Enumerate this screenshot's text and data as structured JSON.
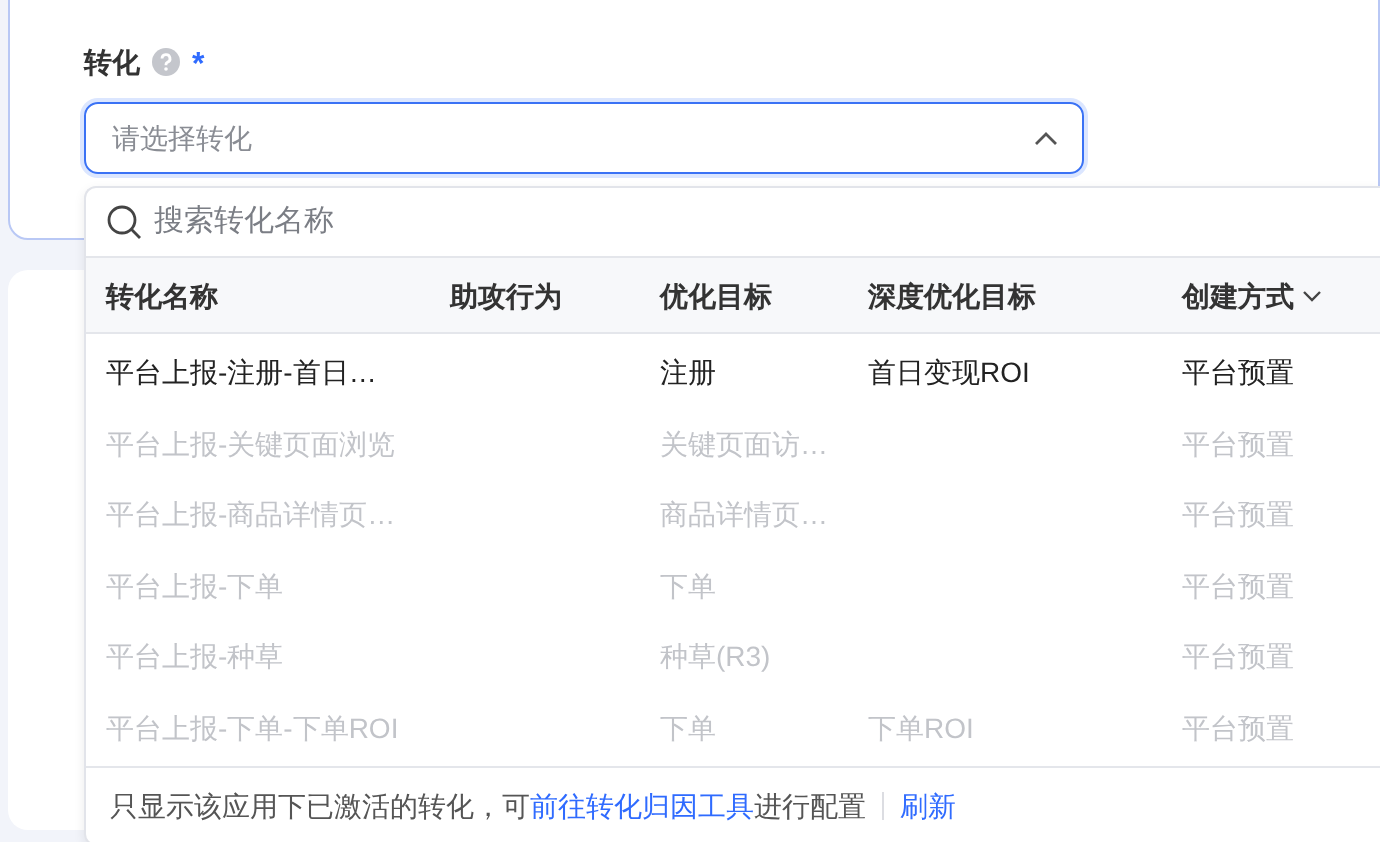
{
  "field": {
    "label": "转化",
    "required_mark": "*",
    "placeholder": "请选择转化",
    "expanded": true
  },
  "dropdown": {
    "search": {
      "placeholder": "搜索转化名称"
    },
    "table": {
      "columns": [
        {
          "label": "转化名称",
          "sortable": false
        },
        {
          "label": "助攻行为",
          "sortable": false
        },
        {
          "label": "优化目标",
          "sortable": false
        },
        {
          "label": "深度优化目标",
          "sortable": false
        },
        {
          "label": "创建方式",
          "sortable": true
        }
      ],
      "rows": [
        {
          "cells": [
            "平台上报-注册-首日…",
            "",
            "注册",
            "首日变现ROI",
            "平台预置"
          ],
          "disabled": false
        },
        {
          "cells": [
            "平台上报-关键页面浏览",
            "",
            "关键页面访…",
            "",
            "平台预置"
          ],
          "disabled": true
        },
        {
          "cells": [
            "平台上报-商品详情页…",
            "",
            "商品详情页…",
            "",
            "平台预置"
          ],
          "disabled": true
        },
        {
          "cells": [
            "平台上报-下单",
            "",
            "下单",
            "",
            "平台预置"
          ],
          "disabled": true
        },
        {
          "cells": [
            "平台上报-种草",
            "",
            "种草(R3)",
            "",
            "平台预置"
          ],
          "disabled": true
        },
        {
          "cells": [
            "平台上报-下单-下单ROI",
            "",
            "下单",
            "下单ROI",
            "平台预置"
          ],
          "disabled": true
        }
      ]
    },
    "footer": {
      "note_before": "只显示该应用下已激活的转化，可",
      "link": "前往转化归因工具",
      "note_after": "进行配置",
      "refresh": "刷新"
    }
  }
}
